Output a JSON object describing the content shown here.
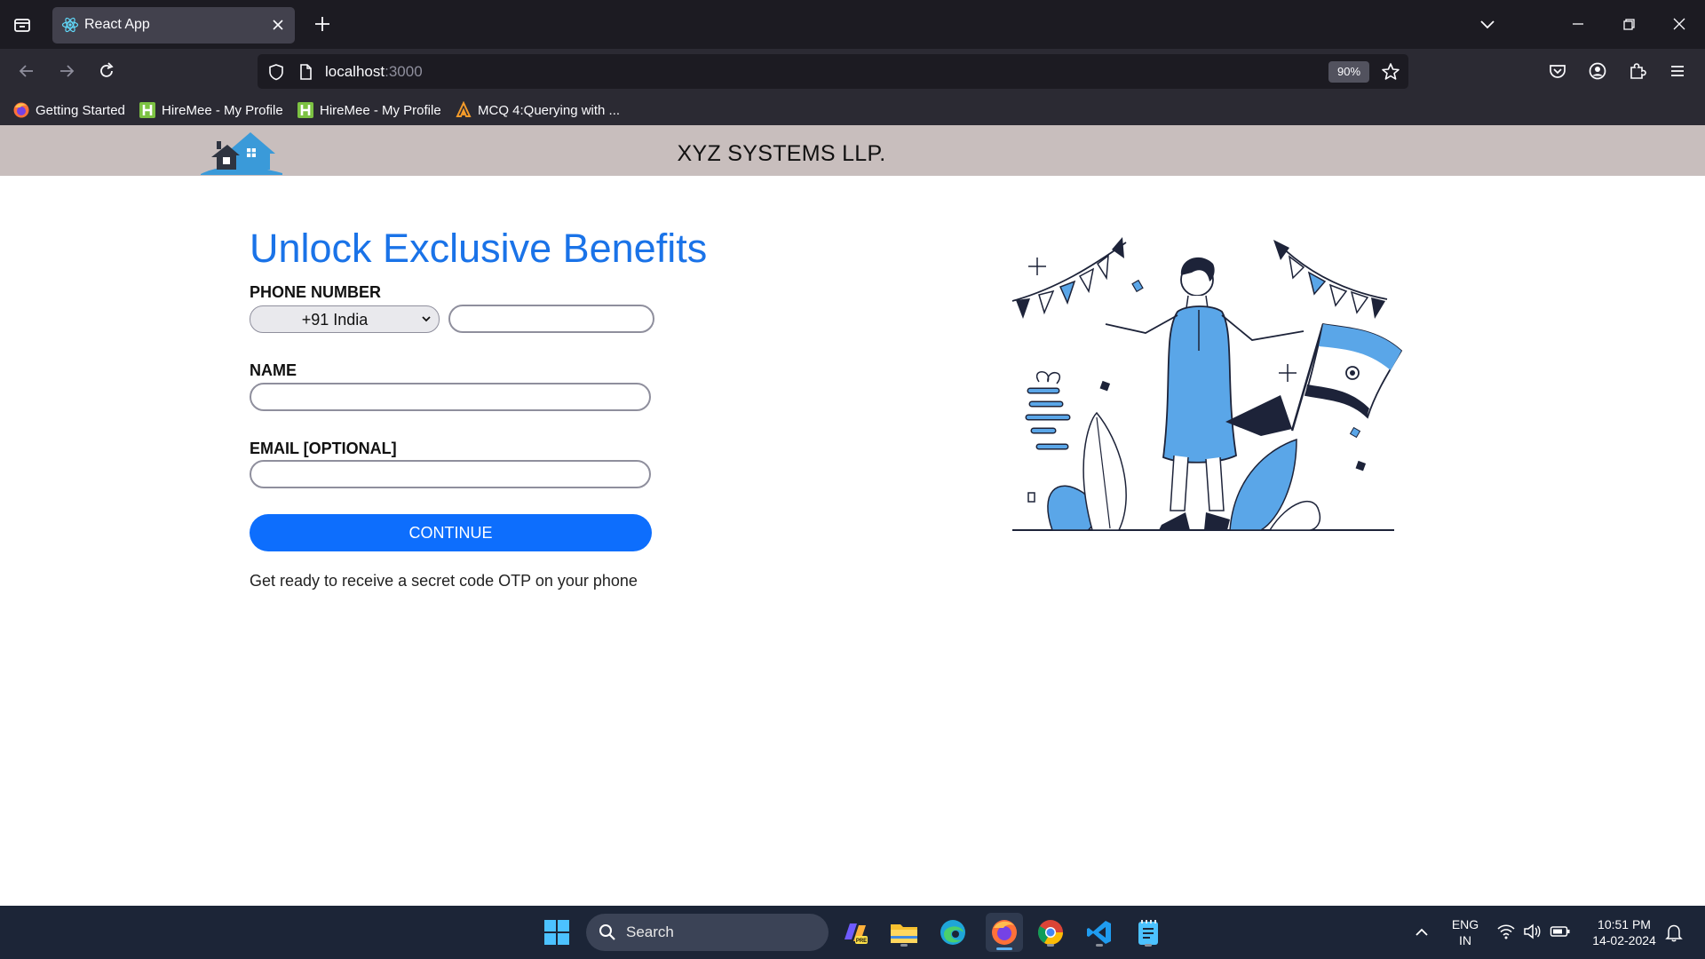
{
  "browser": {
    "tab_title": "React App",
    "url_host": "localhost",
    "url_port": ":3000",
    "zoom": "90%",
    "bookmarks": [
      "Getting Started",
      "HireMee - My Profile",
      "HireMee - My Profile",
      "MCQ 4:Querying with ..."
    ]
  },
  "header": {
    "site_title": "XYZ SYSTEMS LLP."
  },
  "form": {
    "headline": "Unlock Exclusive Benefits",
    "phone_label": "PHONE NUMBER",
    "country_value": "+91 India",
    "phone_value": "",
    "name_label": "NAME",
    "name_value": "",
    "email_label": "EMAIL [OPTIONAL]",
    "email_value": "",
    "continue_label": "CONTINUE",
    "helper_text": "Get ready to receive a secret code OTP on your phone"
  },
  "taskbar": {
    "search_label": "Search",
    "lang_top": "ENG",
    "lang_bottom": "IN",
    "time": "10:51 PM",
    "date": "14-02-2024"
  },
  "colors": {
    "accent_blue": "#0d6efd",
    "headline_blue": "#1a73e8",
    "header_bg": "#c8bebd"
  }
}
